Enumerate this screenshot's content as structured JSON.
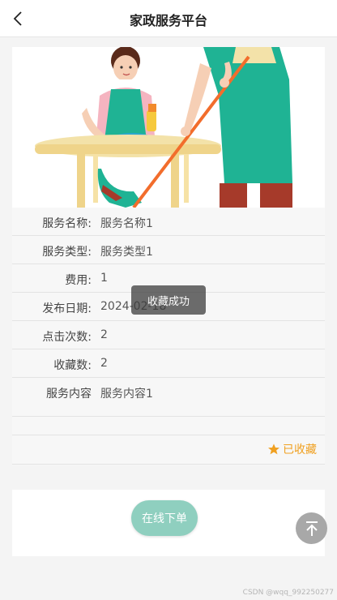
{
  "header": {
    "title": "家政服务平台",
    "back_icon": "chevron-left-icon"
  },
  "detail": {
    "rows": [
      {
        "label": "服务名称:",
        "value": "服务名称1"
      },
      {
        "label": "服务类型:",
        "value": "服务类型1"
      },
      {
        "label": "费用:",
        "value": "1"
      },
      {
        "label": "发布日期:",
        "value": "2024-02-18"
      },
      {
        "label": "点击次数:",
        "value": "2"
      },
      {
        "label": "收藏数:",
        "value": "2"
      },
      {
        "label": "服务内容",
        "value": "服务内容1"
      }
    ]
  },
  "favorite": {
    "label": "已收藏",
    "icon": "star-icon",
    "color": "#f0a020"
  },
  "actions": {
    "order_label": "在线下单",
    "order_color": "#8fcfbf"
  },
  "toast": {
    "text": "收藏成功"
  },
  "back_to_top": {
    "icon": "arrow-up-icon"
  },
  "watermark": "CSDN @wqq_992250277"
}
